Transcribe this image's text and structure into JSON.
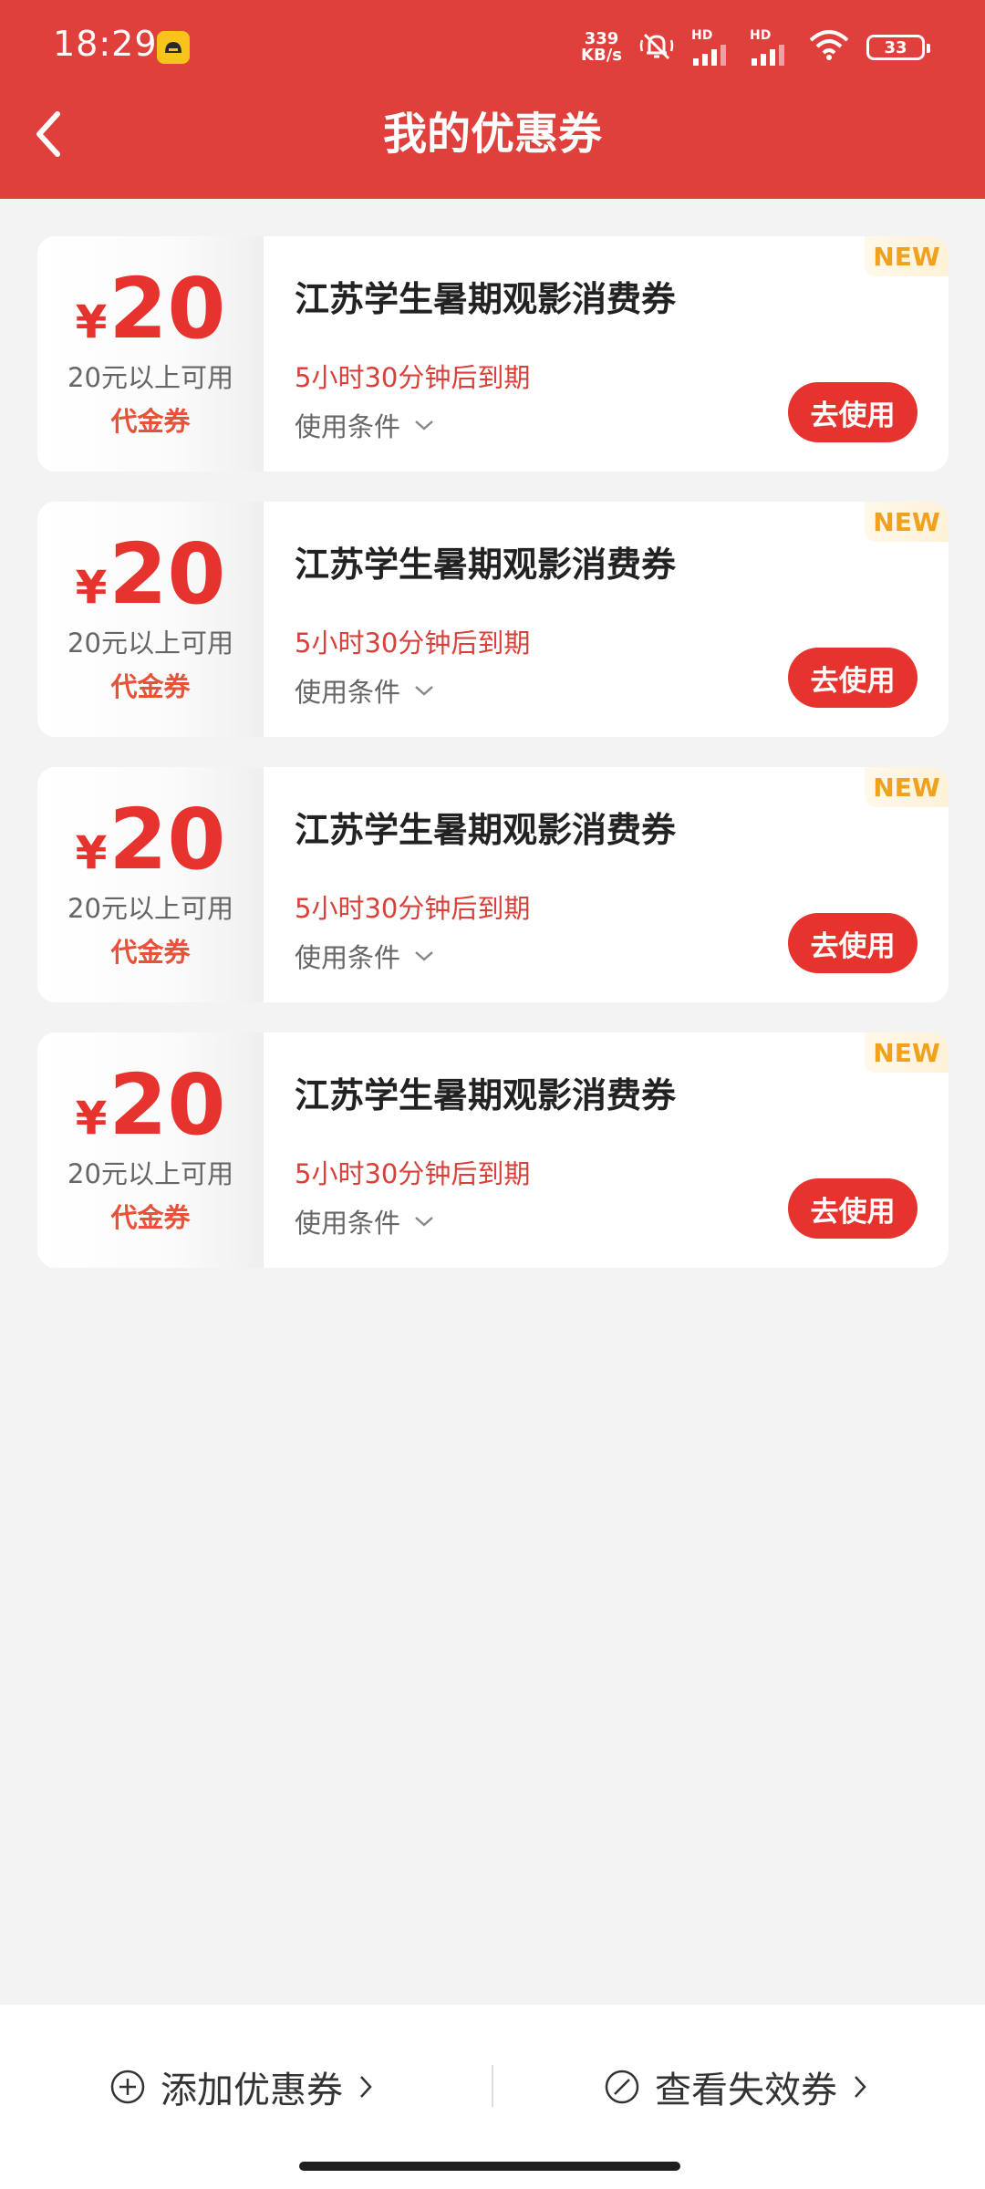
{
  "status_bar": {
    "time": "18:29",
    "net_speed_value": "339",
    "net_speed_unit": "KB/s",
    "hd_label_1": "HD",
    "hd_label_2": "HD",
    "battery": "33"
  },
  "header": {
    "title": "我的优惠券",
    "background_color": "#e0403c"
  },
  "coupons": [
    {
      "currency": "¥",
      "amount": "20",
      "threshold": "20元以上可用",
      "type": "代金券",
      "name": "江苏学生暑期观影消费券",
      "expiry": "5小时30分钟后到期",
      "conditions_label": "使用条件",
      "tag": "NEW",
      "use_label": "去使用"
    },
    {
      "currency": "¥",
      "amount": "20",
      "threshold": "20元以上可用",
      "type": "代金券",
      "name": "江苏学生暑期观影消费券",
      "expiry": "5小时30分钟后到期",
      "conditions_label": "使用条件",
      "tag": "NEW",
      "use_label": "去使用"
    },
    {
      "currency": "¥",
      "amount": "20",
      "threshold": "20元以上可用",
      "type": "代金券",
      "name": "江苏学生暑期观影消费券",
      "expiry": "5小时30分钟后到期",
      "conditions_label": "使用条件",
      "tag": "NEW",
      "use_label": "去使用"
    },
    {
      "currency": "¥",
      "amount": "20",
      "threshold": "20元以上可用",
      "type": "代金券",
      "name": "江苏学生暑期观影消费券",
      "expiry": "5小时30分钟后到期",
      "conditions_label": "使用条件",
      "tag": "NEW",
      "use_label": "去使用"
    }
  ],
  "footer": {
    "add_label": "添加优惠券",
    "expired_label": "查看失效券"
  },
  "colors": {
    "accent": "#e6332e",
    "new_tag": "#f0a21e",
    "page_background": "#f3f3f3"
  }
}
